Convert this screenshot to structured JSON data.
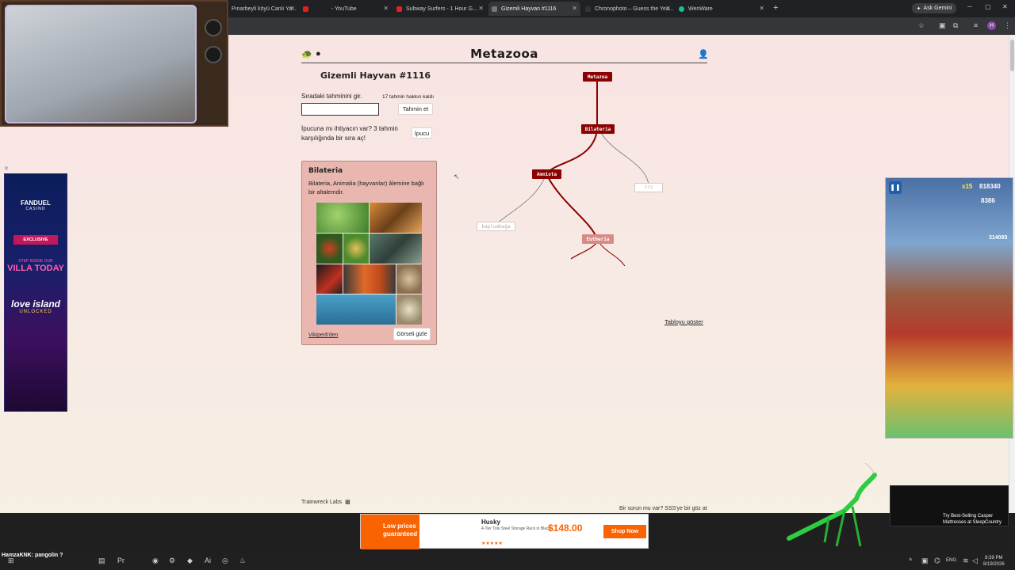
{
  "browser": {
    "tabs": [
      {
        "label": "Pınarbeyli köyü Canlı Ya...",
        "active": false
      },
      {
        "label": "- YouTube",
        "active": false
      },
      {
        "label": "Subway Surfers - 1 Hour G...",
        "active": false
      },
      {
        "label": "Gizemli Hayvan #1116",
        "active": true
      },
      {
        "label": "Chronophoto – Guess the Yea...",
        "active": false
      },
      {
        "label": "WenWare",
        "active": false
      }
    ],
    "new_tab": "+",
    "gemini_label": "Ask Gemini"
  },
  "site": {
    "title": "Metazooa",
    "puzzle_title": "Gizemli Hayvan #1116",
    "guess_label": "Sıradaki tahminini gir.",
    "guesses_left": "17 tahmin hakkın kaldı",
    "guess_input": {
      "value": "",
      "placeholder": ""
    },
    "guess_button": "Tahmin et",
    "hint_text": "İpucuna mı ihtiyacın var? 3 tahmin karşılığında bir sıra aç!",
    "hint_button": "İpucu",
    "card": {
      "title": "Bilateria",
      "description": "Bilateria, Animalia (hayvanlar) âlemine bağlı bir altalemdir.",
      "wiki_link": "Vikipedi'den",
      "hide_image_button": "Görseli gizle"
    },
    "tree": {
      "nodes": [
        {
          "label": "Metazoa",
          "style": "dark"
        },
        {
          "label": "Bilateria",
          "style": "dark"
        },
        {
          "label": "Amniota",
          "style": "dark"
        },
        {
          "label": "???",
          "style": "ghost"
        },
        {
          "label": "kaplumbağa",
          "style": "ghost"
        },
        {
          "label": "Eutheria",
          "style": "faded"
        }
      ]
    },
    "show_table": "Tabloyu göster",
    "footer_left": "Trainwreck Labs",
    "footer_right": "Bir sorun mu var? SSS'ye bir göz at"
  },
  "overlays": {
    "ad_left": {
      "brand": "FANDUEL",
      "sub": "CASINO",
      "exclusive": "EXCLUSIVE",
      "line1": "STEP INSIDE OUR",
      "line2": "VILLA TODAY",
      "line3": "love island",
      "line4": "UNLOCKED"
    },
    "game": {
      "multiplier": "x15",
      "score": "818340",
      "coins": "8386",
      "high_score": "314093"
    },
    "ad_bottom": {
      "badge": "Low prices guaranteed",
      "brand": "Husky",
      "desc": "4-Tier Tote Steel Storage Rack in Black",
      "price": "$148.00",
      "cta": "Shop Now"
    },
    "ad_br": {
      "text": "Try Best-Selling Casper Mattresses at SleepCountry"
    }
  },
  "taskbar": {
    "chat": "HamzaKNK: pangolin ?",
    "lang": "ENG",
    "time": "8:39 PM",
    "date": "8/19/2026"
  }
}
